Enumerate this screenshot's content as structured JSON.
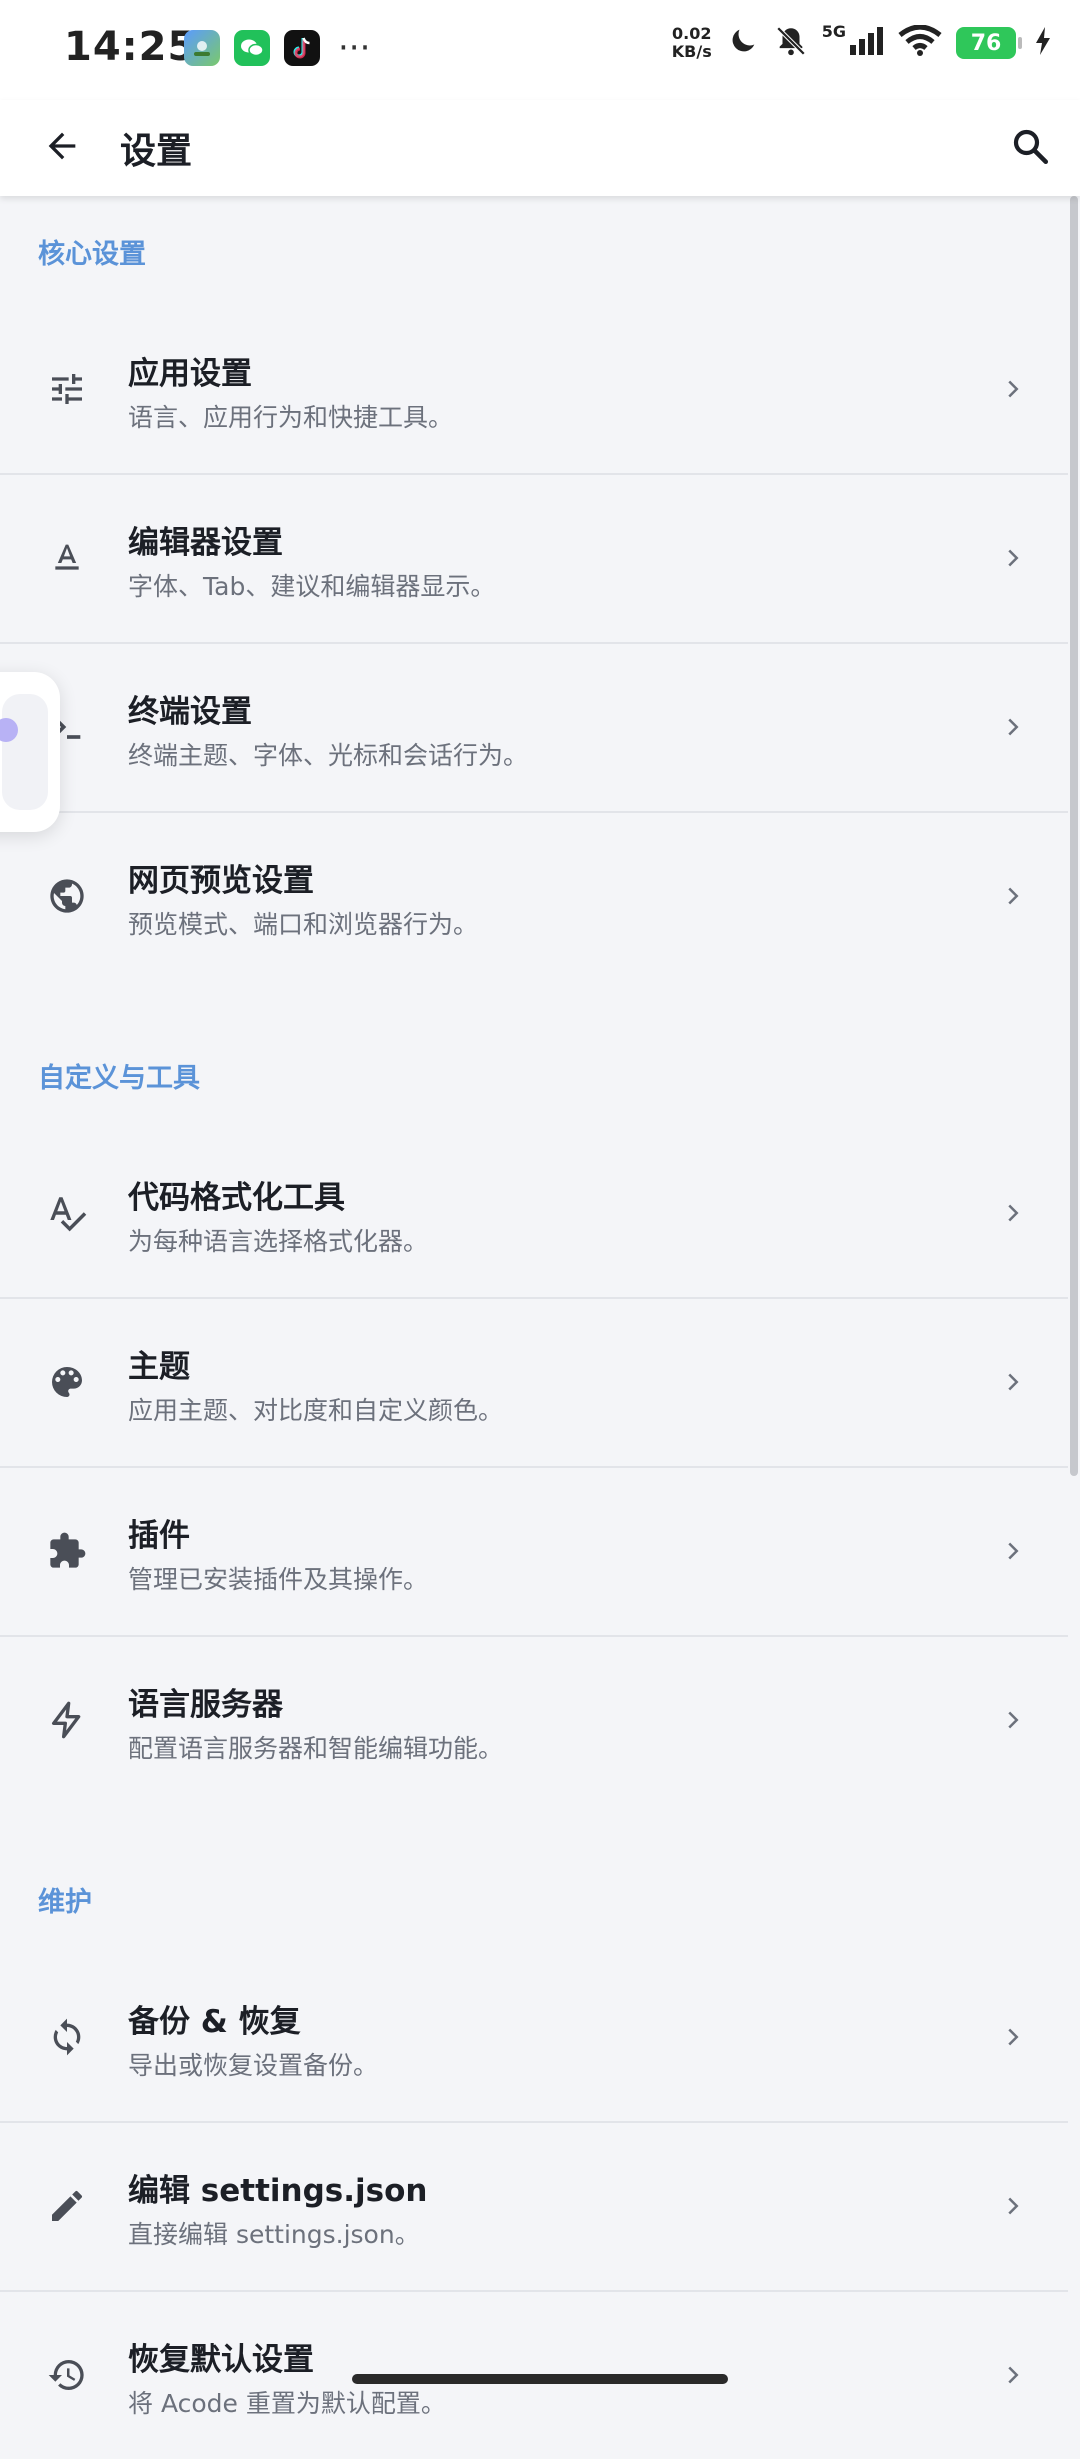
{
  "status_bar": {
    "time": "14:25",
    "speed_value": "0.02",
    "speed_unit": "KB/s",
    "network": "5G",
    "battery": "76",
    "overflow": "···",
    "apps": [
      "app-icon",
      "wechat-icon",
      "tiktok-icon"
    ]
  },
  "app_bar": {
    "title": "设置",
    "back_icon": "arrow-back-icon",
    "search_icon": "search-icon"
  },
  "sections": [
    {
      "title": "核心设置",
      "items": [
        {
          "title": "应用设置",
          "subtitle": "语言、应用行为和快捷工具。",
          "icon": "tune-icon"
        },
        {
          "title": "编辑器设置",
          "subtitle": "字体、Tab、建议和编辑器显示。",
          "icon": "text-format-icon"
        },
        {
          "title": "终端设置",
          "subtitle": "终端主题、字体、光标和会话行为。",
          "icon": "terminal-icon"
        },
        {
          "title": "网页预览设置",
          "subtitle": "预览模式、端口和浏览器行为。",
          "icon": "globe-icon"
        }
      ]
    },
    {
      "title": "自定义与工具",
      "items": [
        {
          "title": "代码格式化工具",
          "subtitle": "为每种语言选择格式化器。",
          "icon": "spellcheck-icon"
        },
        {
          "title": "主题",
          "subtitle": "应用主题、对比度和自定义颜色。",
          "icon": "palette-icon"
        },
        {
          "title": "插件",
          "subtitle": "管理已安装插件及其操作。",
          "icon": "puzzle-icon"
        },
        {
          "title": "语言服务器",
          "subtitle": "配置语言服务器和智能编辑功能。",
          "icon": "bolt-icon"
        }
      ]
    },
    {
      "title": "维护",
      "items": [
        {
          "title": "备份 & 恢复",
          "subtitle": "导出或恢复设置备份。",
          "icon": "sync-icon"
        },
        {
          "title": "编辑 settings.json",
          "subtitle": "直接编辑 settings.json。",
          "icon": "pencil-icon"
        },
        {
          "title": "恢复默认设置",
          "subtitle": "将 Acode 重置为默认配置。",
          "icon": "restore-icon"
        }
      ]
    }
  ],
  "colors": {
    "section_title": "#5b93d8",
    "background": "#f4f5f8",
    "battery": "#2fc75a"
  }
}
